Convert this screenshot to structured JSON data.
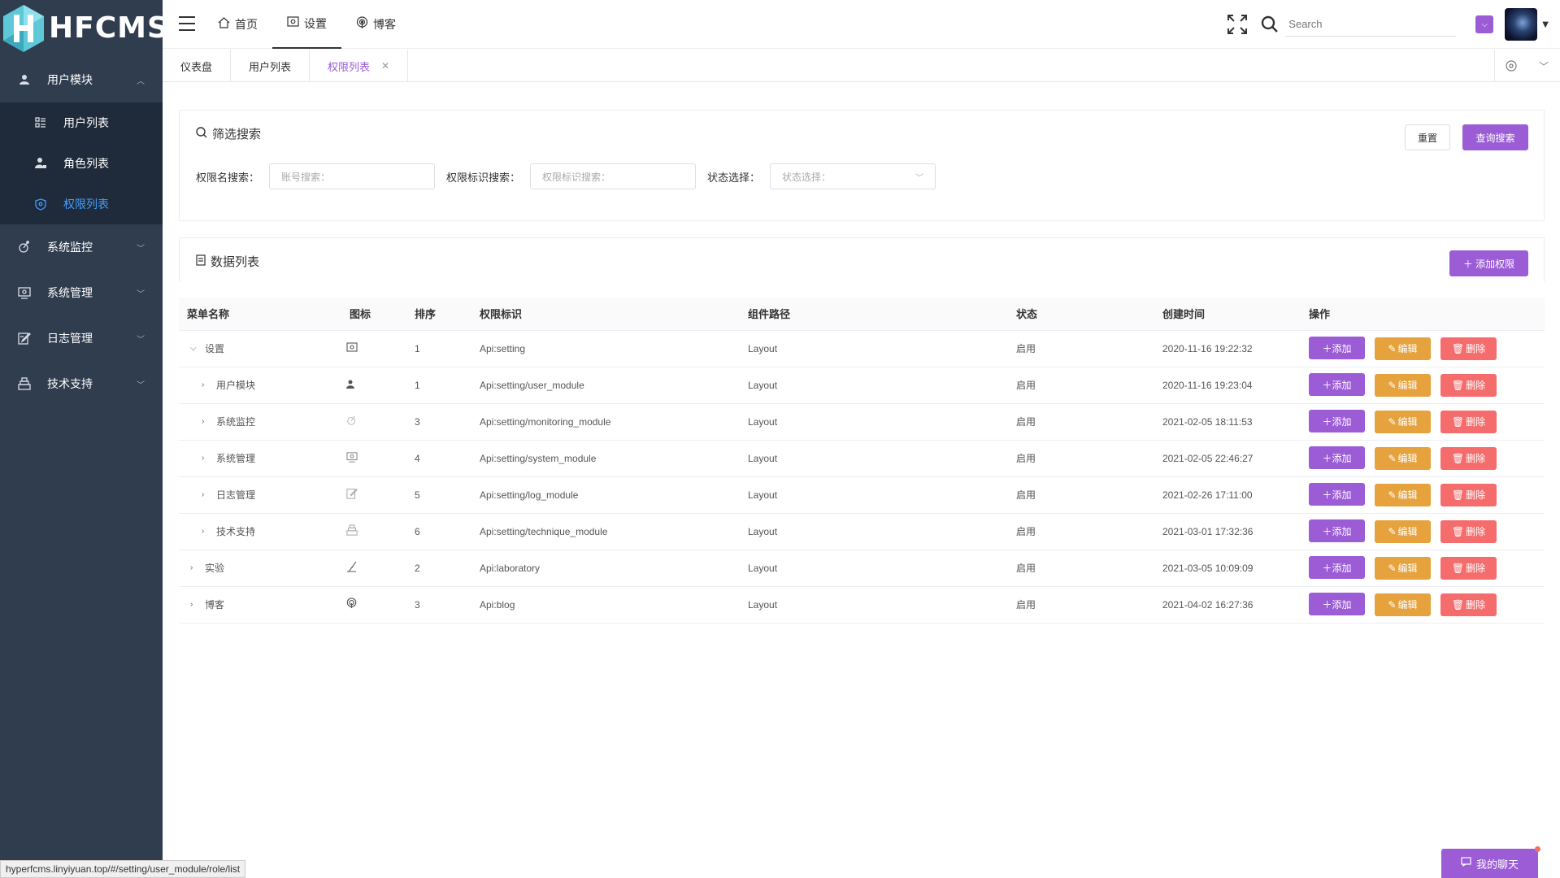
{
  "logo": {
    "text": "HFCMS"
  },
  "sidebar": {
    "groups": [
      {
        "label": "用户模块",
        "icon": "user-icon",
        "expanded": true,
        "items": [
          {
            "label": "用户列表",
            "icon": "list-icon",
            "active": false
          },
          {
            "label": "角色列表",
            "icon": "role-icon",
            "active": false
          },
          {
            "label": "权限列表",
            "icon": "shield-icon",
            "active": true
          }
        ]
      },
      {
        "label": "系统监控",
        "icon": "monitor-icon"
      },
      {
        "label": "系统管理",
        "icon": "system-icon"
      },
      {
        "label": "日志管理",
        "icon": "log-icon"
      },
      {
        "label": "技术支持",
        "icon": "support-icon"
      }
    ]
  },
  "header": {
    "nav": [
      {
        "label": "首页",
        "icon": "home-icon"
      },
      {
        "label": "设置",
        "icon": "settings-icon",
        "active": true
      },
      {
        "label": "博客",
        "icon": "podcast-icon"
      }
    ],
    "search_placeholder": "Search"
  },
  "tabs": [
    {
      "label": "仪表盘"
    },
    {
      "label": "用户列表"
    },
    {
      "label": "权限列表",
      "active": true
    }
  ],
  "filter": {
    "title": "筛选搜索",
    "reset_label": "重置",
    "query_label": "查询搜索",
    "name_label": "权限名搜索：",
    "name_placeholder": "账号搜索：",
    "ident_label": "权限标识搜索：",
    "ident_placeholder": "权限标识搜索：",
    "status_label": "状态选择：",
    "status_placeholder": "状态选择："
  },
  "list": {
    "title": "数据列表",
    "add_label": "＋ 添加权限"
  },
  "table": {
    "columns": [
      "菜单名称",
      "图标",
      "排序",
      "权限标识",
      "组件路径",
      "状态",
      "创建时间",
      "操作"
    ],
    "actions": {
      "add": "＋添加",
      "edit": "编辑",
      "del": "删除"
    },
    "rows": [
      {
        "name": "设置",
        "expander": "⌵",
        "icon": "settings-icon",
        "sort": "1",
        "ident": "Api:setting",
        "path": "Layout",
        "status": "启用",
        "created": "2020-11-16 19:22:32"
      },
      {
        "name": "用户模块",
        "expander": "›",
        "icon": "user-icon",
        "sort": "1",
        "ident": "Api:setting/user_module",
        "path": "Layout",
        "status": "启用",
        "created": "2020-11-16 19:23:04"
      },
      {
        "name": "系统监控",
        "expander": "›",
        "icon": "monitor-icon",
        "sort": "3",
        "ident": "Api:setting/monitoring_module",
        "path": "Layout",
        "status": "启用",
        "created": "2021-02-05 18:11:53"
      },
      {
        "name": "系统管理",
        "expander": "›",
        "icon": "system-icon",
        "sort": "4",
        "ident": "Api:setting/system_module",
        "path": "Layout",
        "status": "启用",
        "created": "2021-02-05 22:46:27"
      },
      {
        "name": "日志管理",
        "expander": "›",
        "icon": "log-icon",
        "sort": "5",
        "ident": "Api:setting/log_module",
        "path": "Layout",
        "status": "启用",
        "created": "2021-02-26 17:11:00"
      },
      {
        "name": "技术支持",
        "expander": "›",
        "icon": "support-icon",
        "sort": "6",
        "ident": "Api:setting/technique_module",
        "path": "Layout",
        "status": "启用",
        "created": "2021-03-01 17:32:36"
      },
      {
        "name": "实验",
        "expander": "›",
        "icon": "lab-icon",
        "sort": "2",
        "ident": "Api:laboratory",
        "path": "Layout",
        "status": "启用",
        "created": "2021-03-05 10:09:09"
      },
      {
        "name": "博客",
        "expander": "›",
        "icon": "podcast-icon",
        "sort": "3",
        "ident": "Api:blog",
        "path": "Layout",
        "status": "启用",
        "created": "2021-04-02 16:27:36"
      }
    ]
  },
  "status_url": "hyperfcms.linyiyuan.top/#/setting/user_module/role/list",
  "chat_label": "我的聊天",
  "colors": {
    "accent": "#9b5cd6",
    "sidebar": "#2f3d4f",
    "submenu": "#1f2b3a",
    "active_link": "#409eff",
    "edit": "#e6a23c",
    "danger": "#f56c6c"
  }
}
